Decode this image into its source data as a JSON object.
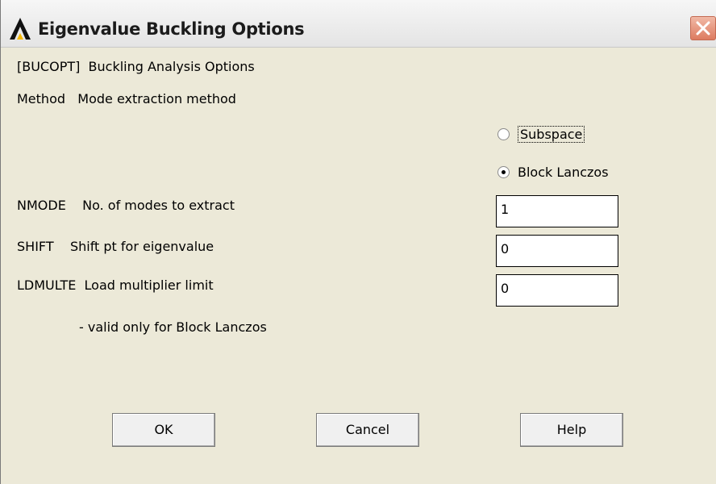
{
  "window": {
    "title": "Eigenvalue Buckling Options"
  },
  "header": {
    "command_label": "[BUCOPT]  Buckling Analysis Options",
    "method_label": "Method   Mode extraction method"
  },
  "method_options": [
    {
      "label": "Subspace",
      "selected": false
    },
    {
      "label": "Block Lanczos",
      "selected": true
    }
  ],
  "fields": {
    "nmode_label": "NMODE    No. of modes to extract",
    "nmode_value": "1",
    "shift_label": "SHIFT    Shift pt for eigenvalue",
    "shift_value": "0",
    "ldmulte_label": "LDMULTE  Load multiplier limit",
    "ldmulte_value": "0",
    "ldmulte_note": "- valid only for Block Lanczos"
  },
  "buttons": {
    "ok": "OK",
    "cancel": "Cancel",
    "help": "Help"
  },
  "icons": {
    "app": "ansys-logo-icon",
    "close": "close-icon"
  }
}
